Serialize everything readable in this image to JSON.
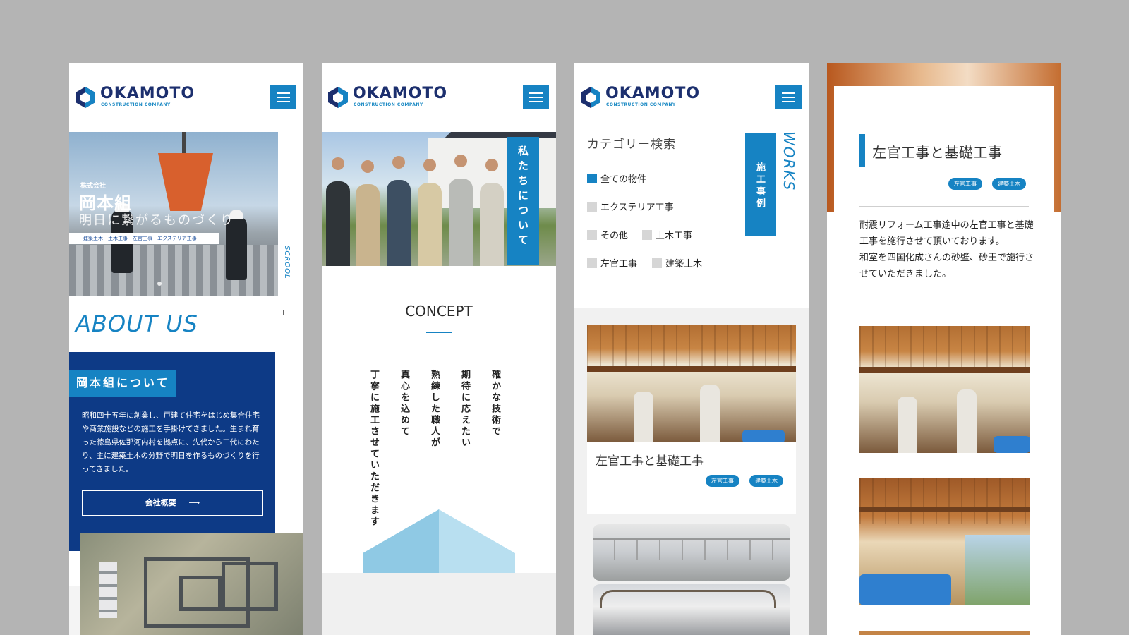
{
  "brand": {
    "name": "OKAMOTO",
    "subtitle": "CONSTRUCTION COMPANY",
    "colors": {
      "primary": "#1683c3",
      "navy": "#0d3a86",
      "logo": "#1c2f6e"
    }
  },
  "icons": {
    "menu": "hamburger-icon",
    "logo": "hexagon-logo-icon",
    "arrow": "arrow-right-icon"
  },
  "panel1": {
    "hero": {
      "company_prefix": "株式会社",
      "company_name": "岡本組",
      "catchphrase": "明日に繋がるものづくり",
      "tags": "建築土木　土木工事　左官工事　エクステリア工事"
    },
    "scroll_label": "SCROOL",
    "about_title": "ABOUT US",
    "about_label": "岡本組について",
    "about_text": "昭和四十五年に創業し、戸建て住宅をはじめ集合住宅や商業施設などの施工を手掛けてきました。生まれ育った徳島県佐那河内村を拠点に、先代から二代にわたり、主に建築土木の分野で明日を作るものづくりを行ってきました。",
    "about_button": "会社概要"
  },
  "panel2": {
    "hero_tab": "私たちについて",
    "concept_title": "CONCEPT",
    "concept_lines": [
      "確かな技術で",
      "期待に応えたい",
      "熟練した職人が",
      "真心を込めて",
      "丁寧に施工させていただきます"
    ]
  },
  "panel3": {
    "category_title": "カテゴリー検索",
    "categories": [
      "全ての物件",
      "エクステリア工事",
      "その他",
      "土木工事",
      "左官工事",
      "建築土木"
    ],
    "active_category": "全ての物件",
    "works_tab": "施工事例",
    "works_en": "WORKS",
    "card": {
      "title": "左官工事と基礎工事",
      "tags": [
        "左官工事",
        "建築土木"
      ]
    }
  },
  "panel4": {
    "title": "左官工事と基礎工事",
    "tags": [
      "左官工事",
      "建築土木"
    ],
    "body": "耐震リフォーム工事途中の左官工事と基礎工事を施行させて頂いております。",
    "body2": "和室を四国化成さんの砂壁、砂王で施行させていただきました。"
  }
}
